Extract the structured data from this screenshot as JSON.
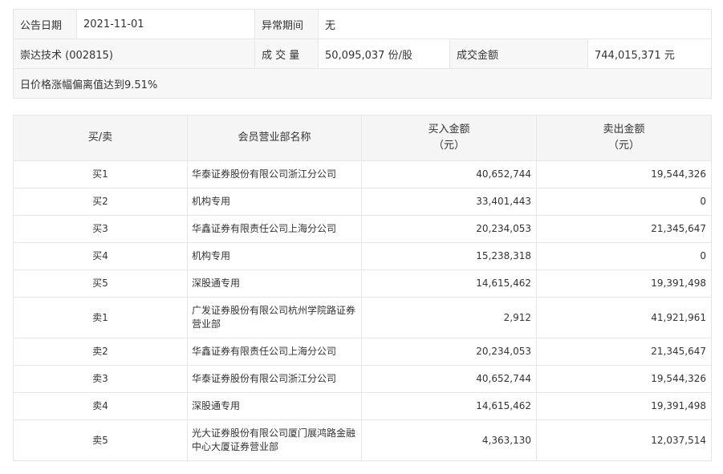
{
  "info": {
    "date_label": "公告日期",
    "date_value": "2021-11-01",
    "period_label": "异常期间",
    "period_value": "无",
    "stock": "崇达技术 (002815)",
    "volume_label": "成 交 量",
    "volume_value": "50,095,037 份/股",
    "amount_label": "成交金额",
    "amount_value": "744,015,371 元",
    "reason": "日价格涨幅偏离值达到9.51%"
  },
  "table": {
    "headers": {
      "side": "买/卖",
      "member": "会员营业部名称",
      "buy_line1": "买入金额",
      "buy_line2": "（元）",
      "sell_line1": "卖出金额",
      "sell_line2": "（元）"
    },
    "rows": [
      {
        "side": "买1",
        "member": "华泰证券股份有限公司浙江分公司",
        "buy": "40,652,744",
        "sell": "19,544,326"
      },
      {
        "side": "买2",
        "member": "机构专用",
        "buy": "33,401,443",
        "sell": "0"
      },
      {
        "side": "买3",
        "member": "华鑫证券有限责任公司上海分公司",
        "buy": "20,234,053",
        "sell": "21,345,647"
      },
      {
        "side": "买4",
        "member": "机构专用",
        "buy": "15,238,318",
        "sell": "0"
      },
      {
        "side": "买5",
        "member": "深股通专用",
        "buy": "14,615,462",
        "sell": "19,391,498"
      },
      {
        "side": "卖1",
        "member": "广发证券股份有限公司杭州学院路证券营业部",
        "buy": "2,912",
        "sell": "41,921,961"
      },
      {
        "side": "卖2",
        "member": "华鑫证券有限责任公司上海分公司",
        "buy": "20,234,053",
        "sell": "21,345,647"
      },
      {
        "side": "卖3",
        "member": "华泰证券股份有限公司浙江分公司",
        "buy": "40,652,744",
        "sell": "19,544,326"
      },
      {
        "side": "卖4",
        "member": "深股通专用",
        "buy": "14,615,462",
        "sell": "19,391,498"
      },
      {
        "side": "卖5",
        "member": "光大证券股份有限公司厦门展鸿路金融中心大厦证券营业部",
        "buy": "4,363,130",
        "sell": "12,037,514"
      }
    ]
  }
}
